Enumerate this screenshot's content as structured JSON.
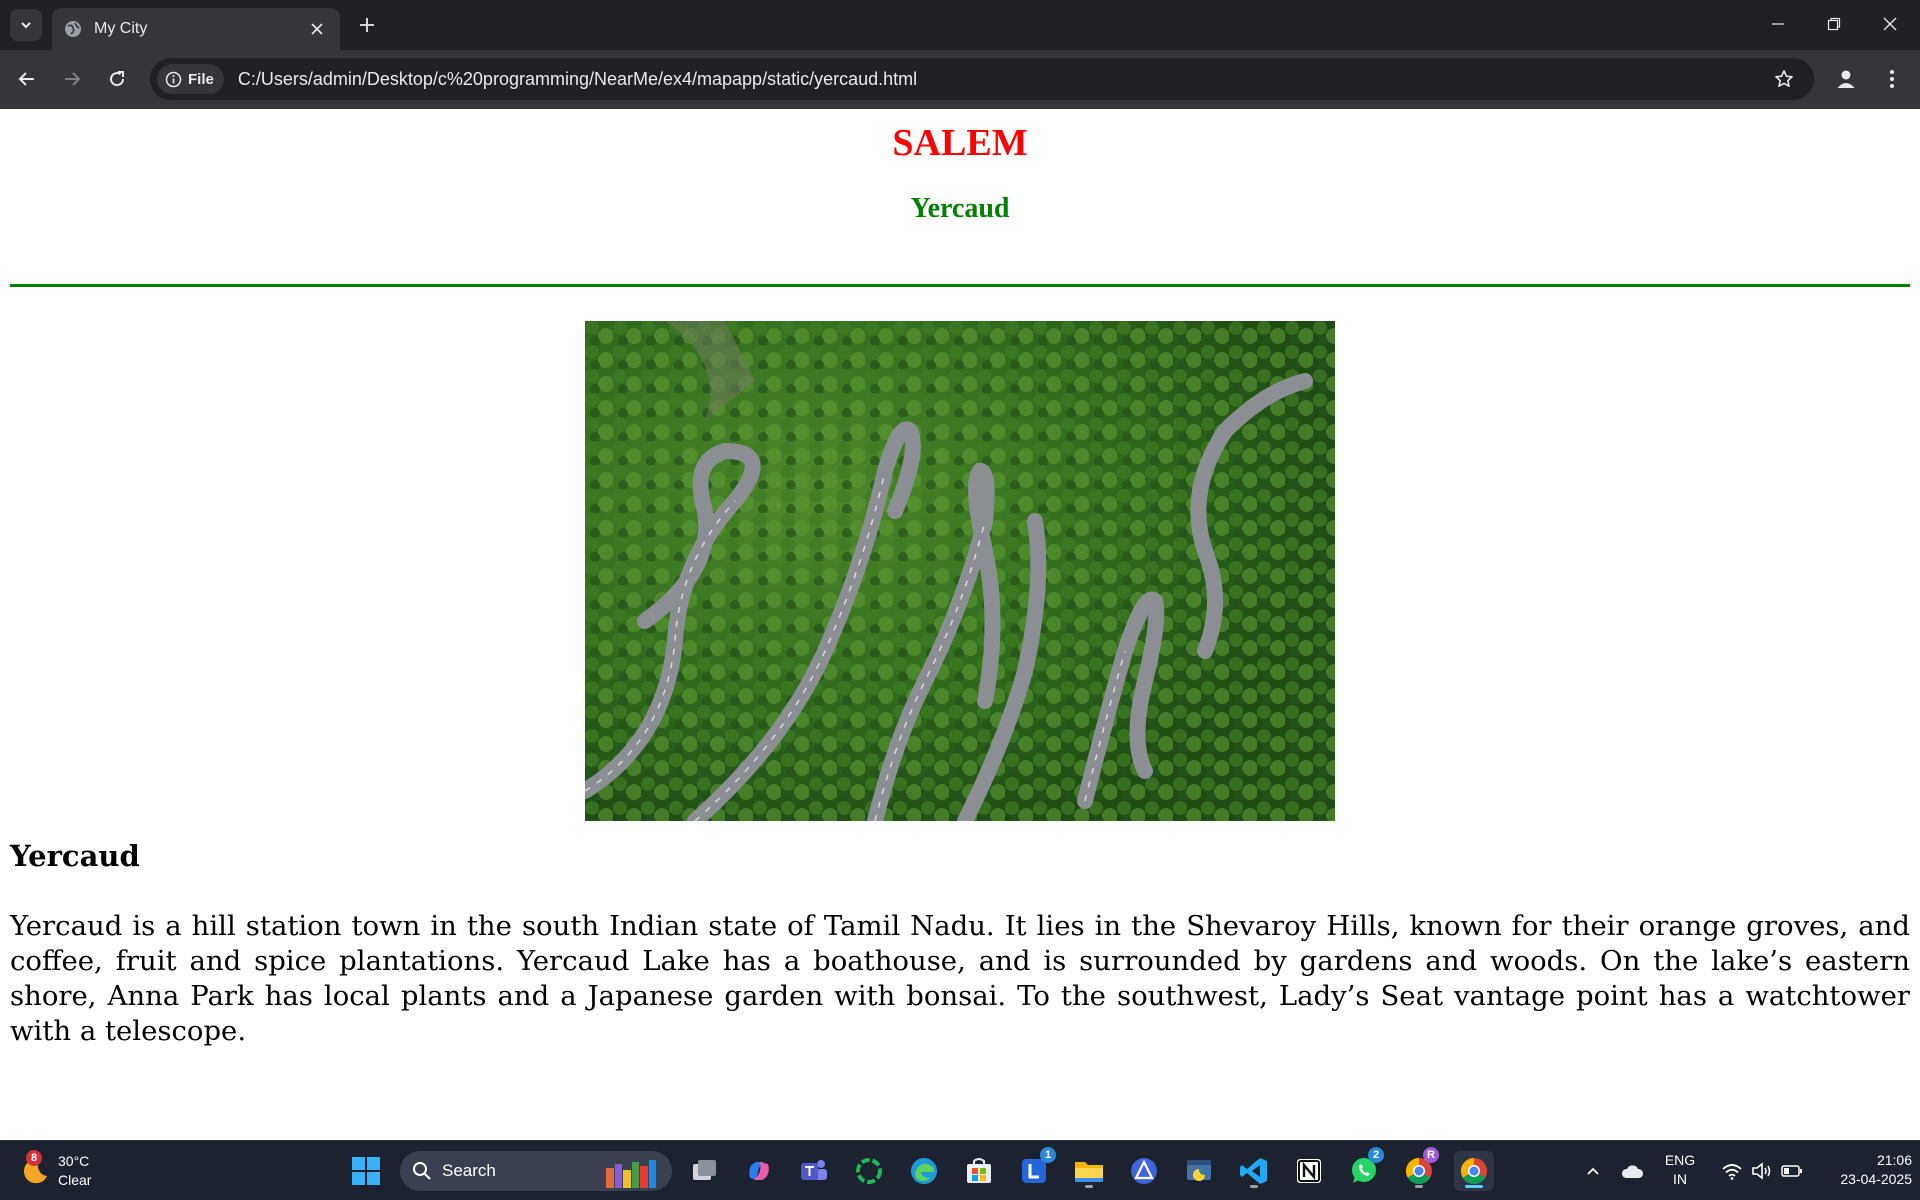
{
  "browser": {
    "tab_title": "My City",
    "security_chip": "File",
    "url": "C:/Users/admin/Desktop/c%20programming/NearMe/ex4/mapapp/static/yercaud.html"
  },
  "page": {
    "city": "SALEM",
    "place": "Yercaud",
    "section_title": "Yercaud",
    "description": "Yercaud is a hill station town in the south Indian state of Tamil Nadu. It lies in the Shevaroy Hills, known for their orange groves, and coffee, fruit and spice plantations. Yercaud Lake has a boathouse, and is surrounded by gardens and woods. On the lake’s eastern shore, Anna Park has local plants and a Japanese garden with bonsai. To the southwest, Lady’s Seat vantage point has a watchtower with a telescope.",
    "colors": {
      "city": "#ff0000",
      "place": "#008000",
      "rule": "#008000"
    }
  },
  "taskbar": {
    "weather_badge": "8",
    "temperature": "30°C",
    "condition": "Clear",
    "search_label": "Search",
    "badges": {
      "lens": "1",
      "whatsapp": "2",
      "chrome_profile": "R"
    },
    "language_line1": "ENG",
    "language_line2": "IN",
    "time": "21:06",
    "date": "23-04-2025"
  }
}
